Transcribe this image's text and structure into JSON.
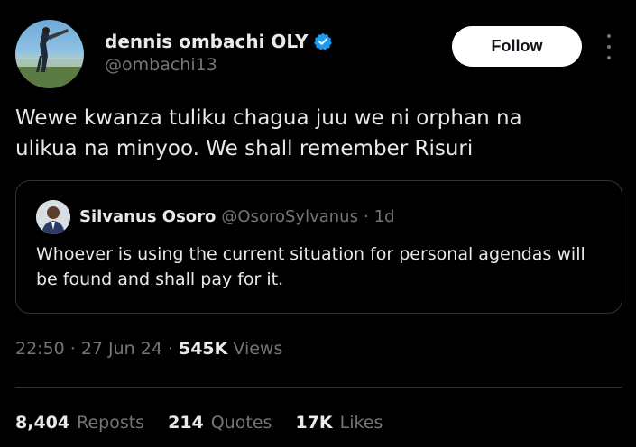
{
  "author": {
    "display_name": "dennis ombachi OLY",
    "handle": "@ombachi13",
    "verified": true
  },
  "follow_label": "Follow",
  "tweet": {
    "text": "Wewe kwanza tuliku chagua juu we ni orphan na\nulikua na minyoo. We shall remember Risuri"
  },
  "quoted": {
    "name": "Silvanus Osoro",
    "handle": "@OsoroSylvanus",
    "separator": "·",
    "time": "1d",
    "text": "Whoever is using the current situation for personal agendas will be found and shall pay for it."
  },
  "meta": {
    "time": "22:50",
    "sep1": "·",
    "date": "27 Jun 24",
    "sep2": "·",
    "views_count": "545K",
    "views_label": "Views"
  },
  "stats": {
    "reposts_count": "8,404",
    "reposts_label": "Reposts",
    "quotes_count": "214",
    "quotes_label": "Quotes",
    "likes_count": "17K",
    "likes_label": "Likes"
  },
  "colors": {
    "background": "#000000",
    "text_primary": "#e7e9ea",
    "text_secondary": "#71767b",
    "border": "#2f3336",
    "verified_blue": "#1d9bf0",
    "follow_bg": "#ffffff"
  }
}
